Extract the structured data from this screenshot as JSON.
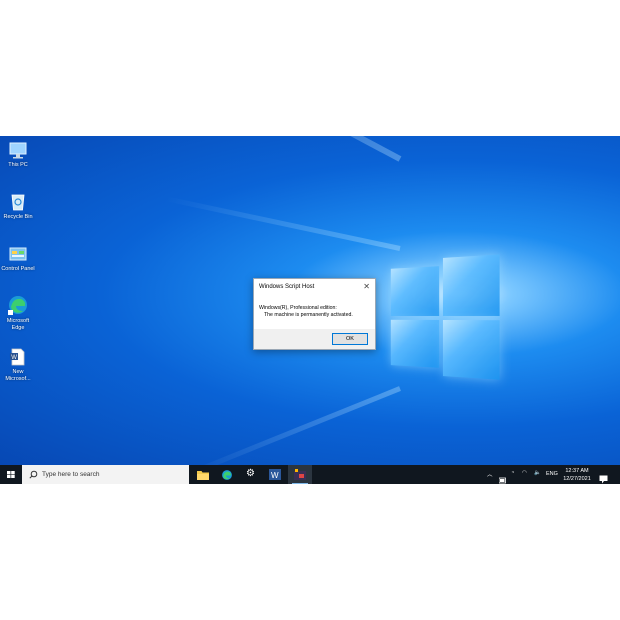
{
  "desktop": {
    "icons": [
      {
        "label_lines": [
          "This PC"
        ],
        "icon": "computer-icon"
      },
      {
        "label_lines": [
          "Recycle Bin"
        ],
        "icon": "recycle-bin-icon"
      },
      {
        "label_lines": [
          "Control Panel"
        ],
        "icon": "control-panel-icon"
      },
      {
        "label_lines": [
          "Microsoft",
          "Edge"
        ],
        "icon": "edge-icon"
      },
      {
        "label_lines": [
          "New",
          "Microsof..."
        ],
        "icon": "word-document-icon"
      }
    ]
  },
  "dialog": {
    "title": "Windows Script Host",
    "line1": "Windows(R), Professional edition:",
    "line2": "The machine is permanently activated.",
    "ok_label": "OK"
  },
  "taskbar": {
    "search_placeholder": "Type here to search",
    "pinned": [
      "file-explorer-icon",
      "edge-icon",
      "settings-gear-icon",
      "word-icon",
      "media-app-icon"
    ],
    "tray": {
      "language": "ENG",
      "time": "12:37 AM",
      "date": "12/27/2021"
    }
  },
  "colors": {
    "desktop_blue": "#0a63d6",
    "taskbar": "#10171f",
    "accent": "#0078d7"
  }
}
